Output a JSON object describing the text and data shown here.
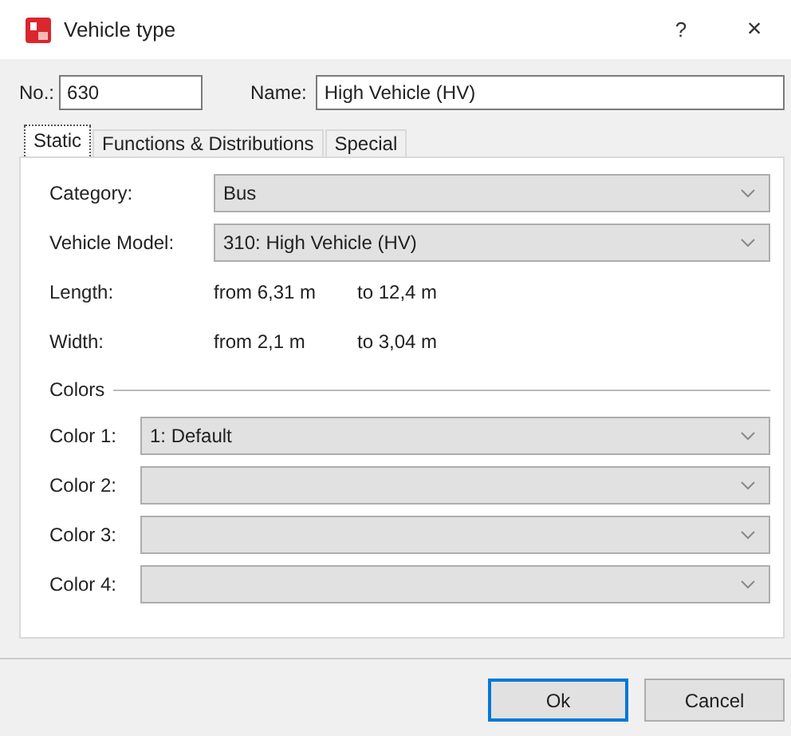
{
  "window": {
    "title": "Vehicle type",
    "help_button": "?",
    "close_button": "×"
  },
  "header": {
    "number": {
      "label": "No.:",
      "value": "630"
    },
    "name": {
      "label": "Name:",
      "value": "High Vehicle (HV)"
    }
  },
  "tabs": [
    {
      "label": "Static",
      "selected": true
    },
    {
      "label": "Functions & Distributions",
      "selected": false
    },
    {
      "label": "Special",
      "selected": false
    }
  ],
  "fields": [
    {
      "kind": "dropdown",
      "label": "Category:",
      "value": "Bus"
    },
    {
      "kind": "dropdown",
      "label": "Vehicle Model:",
      "value": "310: High Vehicle (HV)"
    },
    {
      "kind": "range",
      "label": "Length:",
      "from": "from 6,31 m",
      "to": "to 12,4 m"
    },
    {
      "kind": "range",
      "label": "Width:",
      "from": "from 2,1 m",
      "to": "to 3,04 m"
    }
  ],
  "colors": {
    "title": "Colors",
    "items": [
      {
        "label": "Color 1:",
        "value": "1: Default"
      },
      {
        "label": "Color 2:"
      },
      {
        "label": "Color 3:"
      },
      {
        "label": "Color 4:"
      }
    ]
  },
  "buttons": [
    {
      "label": "Ok",
      "default": true
    },
    {
      "label": "Cancel",
      "default": false
    }
  ]
}
